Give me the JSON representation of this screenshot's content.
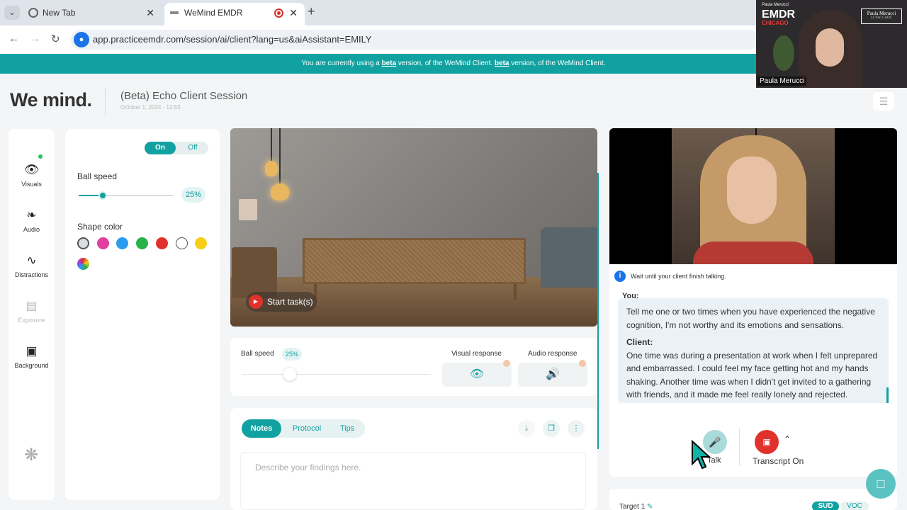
{
  "browser": {
    "tabs": [
      {
        "label": "New Tab"
      },
      {
        "label": "WeMind EMDR"
      }
    ],
    "url": "app.practiceemdr.com/session/ai/client?lang=us&aiAssistant=EMILY"
  },
  "banner": {
    "pre": "You are currently using a ",
    "beta1": "beta",
    "mid": " version, of the WeMind Client. ",
    "beta2": "beta",
    "post": " version, of the WeMind Client."
  },
  "header": {
    "logo": "We mind.",
    "session_title": "(Beta) Echo Client Session",
    "session_date": "October 1, 2024 - 12:53"
  },
  "sidebar": {
    "items": [
      {
        "label": "Visuals",
        "icon": "eye-icon"
      },
      {
        "label": "Audio",
        "icon": "ear-icon"
      },
      {
        "label": "Distractions",
        "icon": "pulse-icon"
      },
      {
        "label": "Exposure",
        "icon": "images-icon"
      },
      {
        "label": "Background",
        "icon": "image-icon"
      }
    ]
  },
  "settings": {
    "toggle_on": "On",
    "toggle_off": "Off",
    "ball_speed_label": "Ball speed",
    "ball_speed_value": "25%",
    "ball_speed_fraction": 0.25,
    "shape_color_label": "Shape color",
    "colors": [
      "#d9dde0",
      "#e03fa0",
      "#2d9bf0",
      "#27b24a",
      "#e0322b",
      "#ffffff",
      "#f7ce16",
      "rainbow"
    ],
    "selected_color_index": 0
  },
  "video": {
    "start_label": "Start task(s)"
  },
  "controls": {
    "ball_speed_label": "Ball speed",
    "ball_speed_value": "25%",
    "ball_speed_fraction": 0.25,
    "visual_response_label": "Visual response",
    "audio_response_label": "Audio response"
  },
  "notes": {
    "tabs": [
      "Notes",
      "Protocol",
      "Tips"
    ],
    "active_tab": "Notes",
    "placeholder": "Describe your findings here."
  },
  "client": {
    "info_text": "Wait until your client finish talking.",
    "you_label": "You:",
    "you_text": "Tell me one or two times when you have experienced the negative cognition, I'm not worthy and its emotions and sensations.",
    "client_label": "Client:",
    "client_text": "One time was during a presentation at work when I felt unprepared and embarrassed. I could feel my face getting hot and my hands shaking. Another time was when I didn't get invited to a gathering with friends, and it made me feel really lonely and rejected.",
    "talk_label": "Talk",
    "transcript_label": "Transcript On"
  },
  "target": {
    "label": "Target 1",
    "sud": "SUD",
    "voc": "VOC"
  },
  "pip": {
    "logo": "EMDR",
    "logo_sub": "CHICAGO",
    "top_script": "Paula Merucci",
    "sign_name": "Paula Merucci",
    "sign_cred": "LCSW, CADC",
    "name_tag": "Paula Merucci"
  },
  "colors": {
    "accent": "#12a1a1",
    "record": "#e0322b"
  }
}
